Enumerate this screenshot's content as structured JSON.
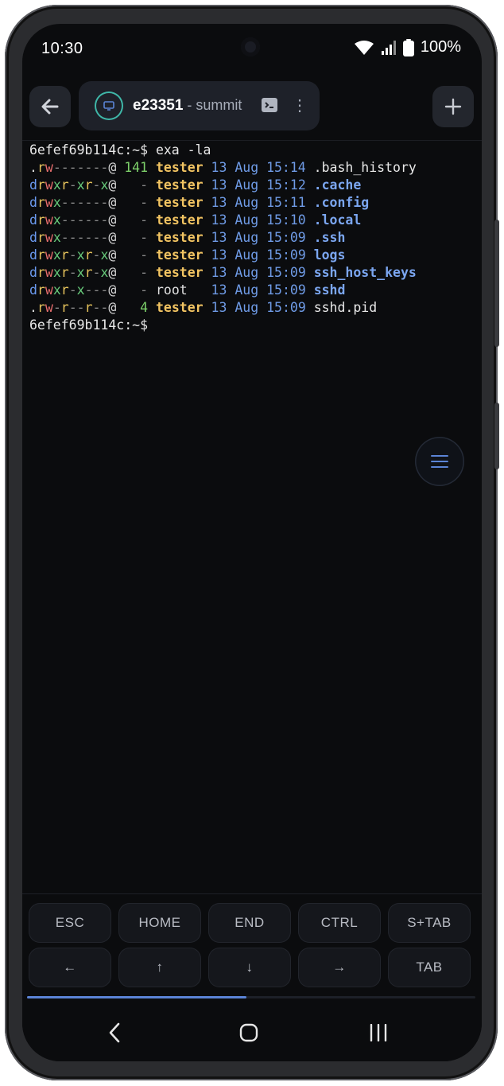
{
  "status_bar": {
    "time": "10:30",
    "battery": "100%"
  },
  "tab": {
    "host": "e23351",
    "separator": " - ",
    "subtitle": "summit",
    "more_label": "⋮"
  },
  "terminal": {
    "lines": [
      [
        {
          "t": "6efef69b114c:~$ exa -la",
          "c": "c-file"
        }
      ],
      [
        {
          "t": ".",
          "c": "c-dot"
        },
        {
          "t": "r",
          "c": "c-r"
        },
        {
          "t": "w",
          "c": "c-w"
        },
        {
          "t": "-------",
          "c": "c-dash"
        },
        {
          "t": "@ ",
          "c": "c-at"
        },
        {
          "t": "141 ",
          "c": "c-size"
        },
        {
          "t": "tester ",
          "c": "c-user"
        },
        {
          "t": "13 Aug 15:14 ",
          "c": "c-date"
        },
        {
          "t": ".bash_history",
          "c": "c-file"
        }
      ],
      [
        {
          "t": "d",
          "c": "c-d"
        },
        {
          "t": "r",
          "c": "c-r"
        },
        {
          "t": "w",
          "c": "c-w"
        },
        {
          "t": "x",
          "c": "c-x"
        },
        {
          "t": "r",
          "c": "c-r"
        },
        {
          "t": "-",
          "c": "c-dash"
        },
        {
          "t": "x",
          "c": "c-x"
        },
        {
          "t": "r",
          "c": "c-r"
        },
        {
          "t": "-",
          "c": "c-dash"
        },
        {
          "t": "x",
          "c": "c-x"
        },
        {
          "t": "@   ",
          "c": "c-at"
        },
        {
          "t": "- ",
          "c": "c-dash"
        },
        {
          "t": "tester ",
          "c": "c-user"
        },
        {
          "t": "13 Aug 15:12 ",
          "c": "c-date"
        },
        {
          "t": ".cache",
          "c": "c-dir"
        }
      ],
      [
        {
          "t": "d",
          "c": "c-d"
        },
        {
          "t": "r",
          "c": "c-r"
        },
        {
          "t": "w",
          "c": "c-w"
        },
        {
          "t": "x",
          "c": "c-x"
        },
        {
          "t": "------",
          "c": "c-dash"
        },
        {
          "t": "@   ",
          "c": "c-at"
        },
        {
          "t": "- ",
          "c": "c-dash"
        },
        {
          "t": "tester ",
          "c": "c-user"
        },
        {
          "t": "13 Aug 15:11 ",
          "c": "c-date"
        },
        {
          "t": ".config",
          "c": "c-dir"
        }
      ],
      [
        {
          "t": "d",
          "c": "c-d"
        },
        {
          "t": "r",
          "c": "c-r"
        },
        {
          "t": "w",
          "c": "c-w"
        },
        {
          "t": "x",
          "c": "c-x"
        },
        {
          "t": "------",
          "c": "c-dash"
        },
        {
          "t": "@   ",
          "c": "c-at"
        },
        {
          "t": "- ",
          "c": "c-dash"
        },
        {
          "t": "tester ",
          "c": "c-user"
        },
        {
          "t": "13 Aug 15:10 ",
          "c": "c-date"
        },
        {
          "t": ".local",
          "c": "c-dir"
        }
      ],
      [
        {
          "t": "d",
          "c": "c-d"
        },
        {
          "t": "r",
          "c": "c-r"
        },
        {
          "t": "w",
          "c": "c-w"
        },
        {
          "t": "x",
          "c": "c-x"
        },
        {
          "t": "------",
          "c": "c-dash"
        },
        {
          "t": "@   ",
          "c": "c-at"
        },
        {
          "t": "- ",
          "c": "c-dash"
        },
        {
          "t": "tester ",
          "c": "c-user"
        },
        {
          "t": "13 Aug 15:09 ",
          "c": "c-date"
        },
        {
          "t": ".ssh",
          "c": "c-dir"
        }
      ],
      [
        {
          "t": "d",
          "c": "c-d"
        },
        {
          "t": "r",
          "c": "c-r"
        },
        {
          "t": "w",
          "c": "c-w"
        },
        {
          "t": "x",
          "c": "c-x"
        },
        {
          "t": "r",
          "c": "c-r"
        },
        {
          "t": "-",
          "c": "c-dash"
        },
        {
          "t": "x",
          "c": "c-x"
        },
        {
          "t": "r",
          "c": "c-r"
        },
        {
          "t": "-",
          "c": "c-dash"
        },
        {
          "t": "x",
          "c": "c-x"
        },
        {
          "t": "@   ",
          "c": "c-at"
        },
        {
          "t": "- ",
          "c": "c-dash"
        },
        {
          "t": "tester ",
          "c": "c-user"
        },
        {
          "t": "13 Aug 15:09 ",
          "c": "c-date"
        },
        {
          "t": "logs",
          "c": "c-dir"
        }
      ],
      [
        {
          "t": "d",
          "c": "c-d"
        },
        {
          "t": "r",
          "c": "c-r"
        },
        {
          "t": "w",
          "c": "c-w"
        },
        {
          "t": "x",
          "c": "c-x"
        },
        {
          "t": "r",
          "c": "c-r"
        },
        {
          "t": "-",
          "c": "c-dash"
        },
        {
          "t": "x",
          "c": "c-x"
        },
        {
          "t": "r",
          "c": "c-r"
        },
        {
          "t": "-",
          "c": "c-dash"
        },
        {
          "t": "x",
          "c": "c-x"
        },
        {
          "t": "@   ",
          "c": "c-at"
        },
        {
          "t": "- ",
          "c": "c-dash"
        },
        {
          "t": "tester ",
          "c": "c-user"
        },
        {
          "t": "13 Aug 15:09 ",
          "c": "c-date"
        },
        {
          "t": "ssh_host_keys",
          "c": "c-dir"
        }
      ],
      [
        {
          "t": "d",
          "c": "c-d"
        },
        {
          "t": "r",
          "c": "c-r"
        },
        {
          "t": "w",
          "c": "c-w"
        },
        {
          "t": "x",
          "c": "c-x"
        },
        {
          "t": "r",
          "c": "c-r"
        },
        {
          "t": "-",
          "c": "c-dash"
        },
        {
          "t": "x",
          "c": "c-x"
        },
        {
          "t": "---",
          "c": "c-dash"
        },
        {
          "t": "@   ",
          "c": "c-at"
        },
        {
          "t": "- ",
          "c": "c-dash"
        },
        {
          "t": "root   ",
          "c": "c-root"
        },
        {
          "t": "13 Aug 15:09 ",
          "c": "c-date"
        },
        {
          "t": "sshd",
          "c": "c-dir"
        }
      ],
      [
        {
          "t": ".",
          "c": "c-dot"
        },
        {
          "t": "r",
          "c": "c-r"
        },
        {
          "t": "w",
          "c": "c-w"
        },
        {
          "t": "-",
          "c": "c-dash"
        },
        {
          "t": "r",
          "c": "c-r"
        },
        {
          "t": "--",
          "c": "c-dash"
        },
        {
          "t": "r",
          "c": "c-r"
        },
        {
          "t": "--",
          "c": "c-dash"
        },
        {
          "t": "@   ",
          "c": "c-at"
        },
        {
          "t": "4 ",
          "c": "c-size"
        },
        {
          "t": "tester ",
          "c": "c-user"
        },
        {
          "t": "13 Aug 15:09 ",
          "c": "c-date"
        },
        {
          "t": "sshd.pid",
          "c": "c-file"
        }
      ],
      [
        {
          "t": "6efef69b114c:~$",
          "c": "c-file"
        }
      ]
    ]
  },
  "extra_keys": {
    "row1": [
      "ESC",
      "HOME",
      "END",
      "CTRL",
      "S+TAB"
    ],
    "row2": [
      "←",
      "↑",
      "↓",
      "→",
      "TAB"
    ]
  },
  "scroll_progress": 0.49,
  "colors": {
    "accent": "#5b84d6",
    "tab_icon_ring": "#3fb7a8",
    "background": "#0b0c0e"
  }
}
